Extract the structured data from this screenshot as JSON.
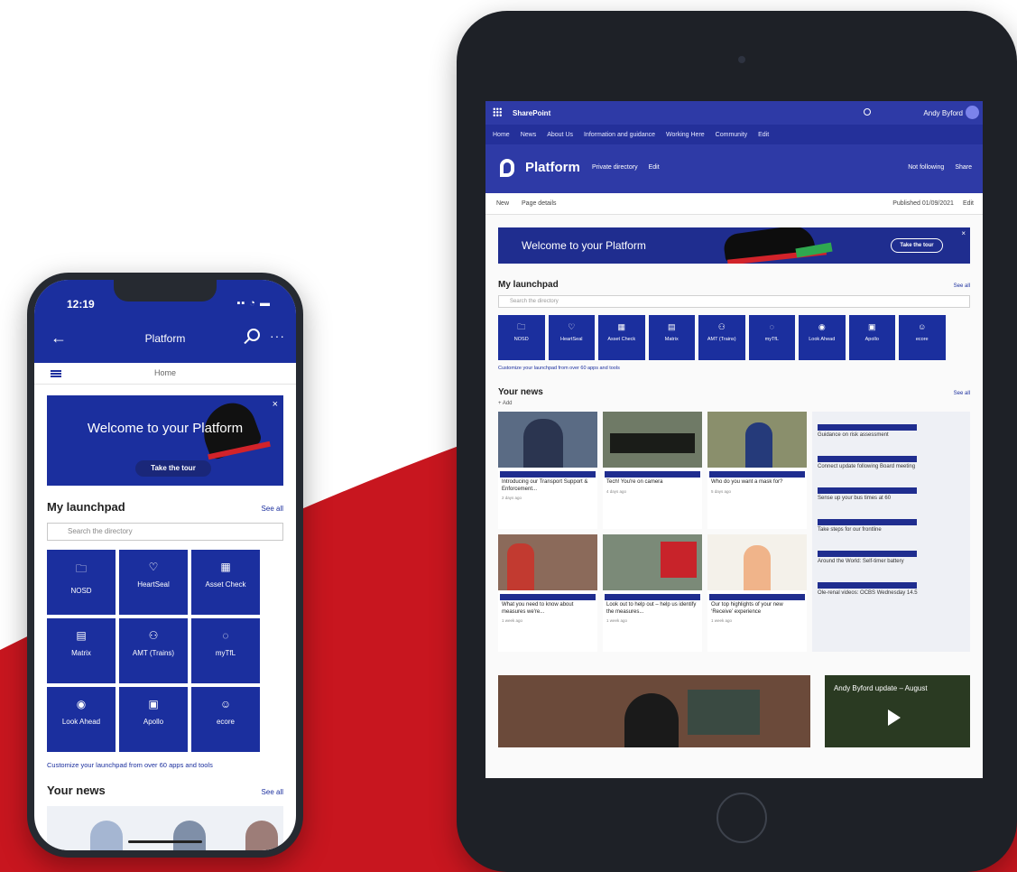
{
  "colors": {
    "brand_blue": "#1b2f9e",
    "accent_red": "#d2232a",
    "device_frame": "#262a31"
  },
  "phone": {
    "status_time": "12:19",
    "app_title": "Platform",
    "nav_label": "Home",
    "banner": {
      "title": "Welcome to your Platform",
      "button": "Take the tour",
      "close": "×"
    },
    "launchpad": {
      "heading": "My launchpad",
      "see_all": "See all",
      "search_placeholder": "Search the directory",
      "tiles": [
        {
          "label": "NOSD",
          "icon": "folder-icon"
        },
        {
          "label": "HeartSeal",
          "icon": "heart-icon"
        },
        {
          "label": "Asset Check",
          "icon": "grid-icon"
        },
        {
          "label": "Matrix",
          "icon": "calendar-icon"
        },
        {
          "label": "AMT (Trains)",
          "icon": "people-icon"
        },
        {
          "label": "myTfL",
          "icon": "apple-icon"
        },
        {
          "label": "Look Ahead",
          "icon": "eye-icon"
        },
        {
          "label": "Apollo",
          "icon": "calculator-icon"
        },
        {
          "label": "ecore",
          "icon": "face-icon"
        }
      ],
      "customize": "Customize your launchpad from over 60 apps and tools"
    },
    "news": {
      "heading": "Your news",
      "see_all": "See all"
    }
  },
  "tablet": {
    "suite_title": "SharePoint",
    "user": "Andy Byford",
    "hub_nav": [
      "Home",
      "News",
      "About Us",
      "Information and guidance",
      "Working Here",
      "Community",
      "Edit"
    ],
    "site": {
      "name": "Platform",
      "links": [
        "Private directory",
        "Edit"
      ],
      "actions": [
        "Not following",
        "Share"
      ]
    },
    "command": {
      "left": [
        "New",
        "Page details"
      ],
      "right": [
        "Published 01/09/2021",
        "Edit"
      ]
    },
    "banner": {
      "title": "Welcome to your Platform",
      "button": "Take the tour",
      "close": "×"
    },
    "launchpad": {
      "heading": "My launchpad",
      "see_all": "See all",
      "search_placeholder": "Search the directory",
      "tiles": [
        {
          "label": "NOSD",
          "icon": "folder-icon"
        },
        {
          "label": "HeartSeal",
          "icon": "heart-icon"
        },
        {
          "label": "Asset Check",
          "icon": "grid-icon"
        },
        {
          "label": "Matrix",
          "icon": "calendar-icon"
        },
        {
          "label": "AMT (Trains)",
          "icon": "people-icon"
        },
        {
          "label": "myTfL",
          "icon": "apple-icon"
        },
        {
          "label": "Look Ahead",
          "icon": "eye-icon"
        },
        {
          "label": "Apollo",
          "icon": "calculator-icon"
        },
        {
          "label": "ecore",
          "icon": "face-icon"
        }
      ],
      "customize": "Customize your launchpad from over 60 apps and tools"
    },
    "news": {
      "heading": "Your news",
      "see_all": "See all",
      "add": "+ Add",
      "cards": [
        {
          "title": "Introducing our Transport Support & Enforcement...",
          "meta": "2 days ago"
        },
        {
          "title": "Tech! You're on camera",
          "meta": "4 days ago"
        },
        {
          "title": "Who do you want a mask for?",
          "meta": "5 days ago"
        },
        {
          "title": "What you need to know about measures we're...",
          "meta": "1 week ago"
        },
        {
          "title": "Look out to help out – help us identify the measures...",
          "meta": "1 week ago"
        },
        {
          "title": "Our top highlights of your new ‘Receive’ experience",
          "meta": "1 week ago"
        }
      ],
      "list": [
        "Guidance on risk assessment",
        "Connect update following Board meeting",
        "Sense up your bus times at 60",
        "Take steps for our frontline",
        "Around the World: Self-timer battery",
        "Ole-renal videos: OCBS Wednesday 14.5"
      ],
      "video_title": "Andy Byford update – August"
    }
  }
}
